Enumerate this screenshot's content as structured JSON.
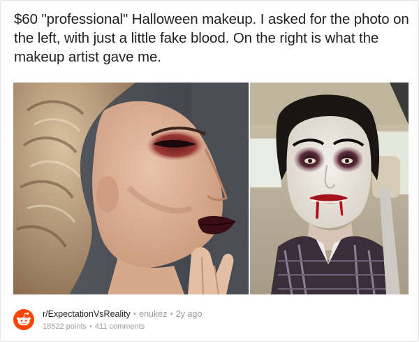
{
  "post": {
    "title": "$60 \"professional\" Halloween makeup. I asked for the photo on the left, with just a little fake blood. On the right is what the makeup artist gave me."
  },
  "footer": {
    "subreddit": "r/ExpectationVsReality",
    "separator": "•",
    "username": "enukez",
    "age": "2y ago",
    "points": "18522 points",
    "comments": "411 comments",
    "avatar_icon": "reddit-snoo-icon",
    "avatar_color": "#ff4500"
  },
  "photos": {
    "left_subject": "woman with dramatic red-smoky eye makeup and dark lipstick",
    "right_subject": "person in car with white face paint, dark eyes and fake blood fangs"
  }
}
